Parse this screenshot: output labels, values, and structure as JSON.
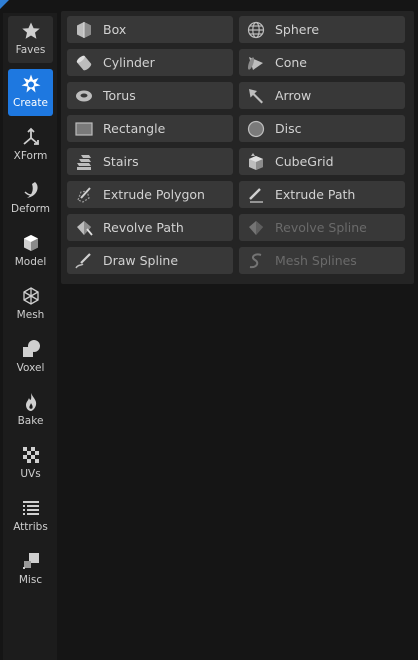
{
  "sidebar": {
    "categories": [
      {
        "label": "Faves",
        "icon": "star-icon",
        "state": "highlighted"
      },
      {
        "label": "Create",
        "icon": "create-icon",
        "state": "active"
      },
      {
        "label": "XForm",
        "icon": "xform-axes-icon"
      },
      {
        "label": "Deform",
        "icon": "deform-icon"
      },
      {
        "label": "Model",
        "icon": "model-cube-icon"
      },
      {
        "label": "Mesh",
        "icon": "mesh-icon"
      },
      {
        "label": "Voxel",
        "icon": "voxel-icon"
      },
      {
        "label": "Bake",
        "icon": "bake-flame-icon"
      },
      {
        "label": "UVs",
        "icon": "uv-checker-icon"
      },
      {
        "label": "Attribs",
        "icon": "attribs-list-icon"
      },
      {
        "label": "Misc",
        "icon": "misc-icon"
      }
    ]
  },
  "tools": [
    {
      "label": "Box",
      "icon": "box-icon",
      "enabled": true
    },
    {
      "label": "Sphere",
      "icon": "sphere-icon",
      "enabled": true
    },
    {
      "label": "Cylinder",
      "icon": "cylinder-icon",
      "enabled": true
    },
    {
      "label": "Cone",
      "icon": "cone-icon",
      "enabled": true
    },
    {
      "label": "Torus",
      "icon": "torus-icon",
      "enabled": true
    },
    {
      "label": "Arrow",
      "icon": "arrow-icon",
      "enabled": true
    },
    {
      "label": "Rectangle",
      "icon": "rectangle-icon",
      "enabled": true
    },
    {
      "label": "Disc",
      "icon": "disc-icon",
      "enabled": true
    },
    {
      "label": "Stairs",
      "icon": "stairs-icon",
      "enabled": true
    },
    {
      "label": "CubeGrid",
      "icon": "cubegrid-icon",
      "enabled": true
    },
    {
      "label": "Extrude Polygon",
      "icon": "extrude-polygon-icon",
      "enabled": true
    },
    {
      "label": "Extrude Path",
      "icon": "extrude-path-icon",
      "enabled": true
    },
    {
      "label": "Revolve Path",
      "icon": "revolve-path-icon",
      "enabled": true
    },
    {
      "label": "Revolve Spline",
      "icon": "revolve-spline-icon",
      "enabled": false
    },
    {
      "label": "Draw Spline",
      "icon": "draw-spline-icon",
      "enabled": true
    },
    {
      "label": "Mesh Splines",
      "icon": "mesh-splines-icon",
      "enabled": false
    }
  ],
  "colors": {
    "accent": "#1e78e0",
    "button": "#383838",
    "panel": "#242424",
    "background": "#151515"
  }
}
